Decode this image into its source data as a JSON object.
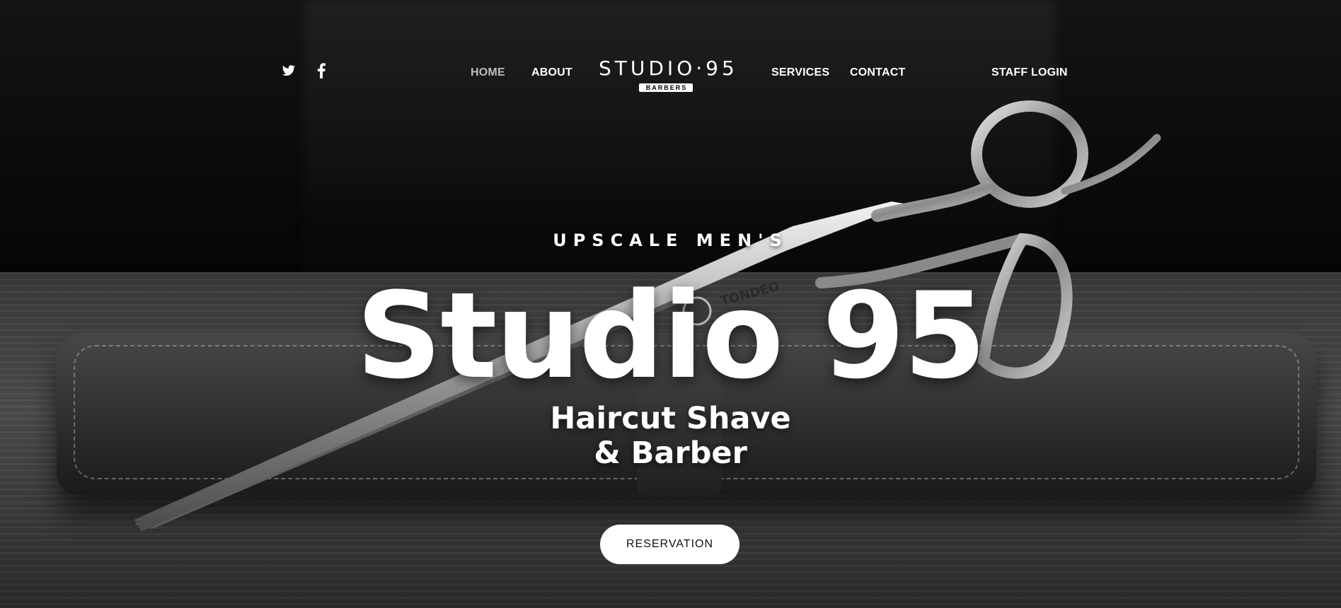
{
  "nav": {
    "social": [
      {
        "icon": "twitter-icon"
      },
      {
        "icon": "facebook-icon"
      }
    ],
    "home": "HOME",
    "about": "ABOUT",
    "services": "SERVICES",
    "contact": "CONTACT",
    "staff_login": "STAFF LOGIN",
    "active_item": "HOME"
  },
  "logo": {
    "main": "STUDIO·95",
    "sub": "BARBERS"
  },
  "hero": {
    "kicker": "UPSCALE MEN'S",
    "title": "Studio 95",
    "subtitle_line1": "Haircut Shave",
    "subtitle_line2": "& Barber",
    "cta": "RESERVATION",
    "photo_brand": "TONDEO"
  },
  "colors": {
    "accent": "#ffffff",
    "nav_active": "#bdbdbd",
    "button_text": "#111111"
  }
}
